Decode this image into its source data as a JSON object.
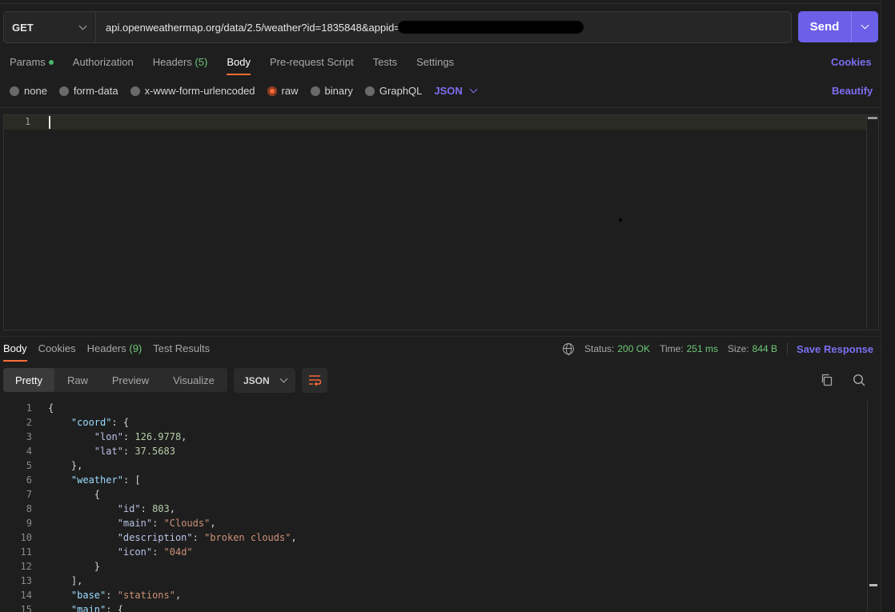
{
  "request": {
    "method": "GET",
    "url": "api.openweathermap.org/data/2.5/weather?id=1835848&appid=",
    "send_label": "Send"
  },
  "request_tabs": [
    {
      "label": "Params",
      "active": false
    },
    {
      "label": "Authorization",
      "active": false
    },
    {
      "label": "Headers",
      "count": "(5)",
      "active": false
    },
    {
      "label": "Body",
      "active": true
    },
    {
      "label": "Pre-request Script",
      "active": false
    },
    {
      "label": "Tests",
      "active": false
    },
    {
      "label": "Settings",
      "active": false
    }
  ],
  "cookies_link": "Cookies",
  "body_types": [
    {
      "label": "none",
      "selected": false
    },
    {
      "label": "form-data",
      "selected": false
    },
    {
      "label": "x-www-form-urlencoded",
      "selected": false
    },
    {
      "label": "raw",
      "selected": true
    },
    {
      "label": "binary",
      "selected": false
    },
    {
      "label": "GraphQL",
      "selected": false
    }
  ],
  "body_format": "JSON",
  "beautify_label": "Beautify",
  "editor": {
    "line_number": "1"
  },
  "response_tabs": [
    {
      "label": "Body",
      "active": true
    },
    {
      "label": "Cookies",
      "active": false
    },
    {
      "label": "Headers",
      "count": "(9)",
      "active": false
    },
    {
      "label": "Test Results",
      "active": false
    }
  ],
  "response_status": {
    "status_label": "Status:",
    "status_value": "200 OK",
    "time_label": "Time:",
    "time_value": "251 ms",
    "size_label": "Size:",
    "size_value": "844 B",
    "save_label": "Save Response"
  },
  "view_modes": [
    {
      "label": "Pretty",
      "active": true
    },
    {
      "label": "Raw",
      "active": false
    },
    {
      "label": "Preview",
      "active": false
    },
    {
      "label": "Visualize",
      "active": false
    }
  ],
  "response_format": "JSON",
  "response_lines": [
    {
      "n": "1",
      "tokens": [
        [
          "p",
          "{"
        ]
      ]
    },
    {
      "n": "2",
      "tokens": [
        [
          "p",
          "    "
        ],
        [
          "k",
          "\"coord\""
        ],
        [
          "p",
          ": {"
        ]
      ]
    },
    {
      "n": "3",
      "tokens": [
        [
          "p",
          "        "
        ],
        [
          "kk",
          "\"lon\""
        ],
        [
          "p",
          ": "
        ],
        [
          "n",
          "126.9778"
        ],
        [
          "p",
          ","
        ]
      ]
    },
    {
      "n": "4",
      "tokens": [
        [
          "p",
          "        "
        ],
        [
          "kk",
          "\"lat\""
        ],
        [
          "p",
          ": "
        ],
        [
          "n",
          "37.5683"
        ]
      ]
    },
    {
      "n": "5",
      "tokens": [
        [
          "p",
          "    },"
        ]
      ]
    },
    {
      "n": "6",
      "tokens": [
        [
          "p",
          "    "
        ],
        [
          "k",
          "\"weather\""
        ],
        [
          "p",
          ": ["
        ]
      ]
    },
    {
      "n": "7",
      "tokens": [
        [
          "p",
          "        {"
        ]
      ]
    },
    {
      "n": "8",
      "tokens": [
        [
          "p",
          "            "
        ],
        [
          "kk",
          "\"id\""
        ],
        [
          "p",
          ": "
        ],
        [
          "n",
          "803"
        ],
        [
          "p",
          ","
        ]
      ]
    },
    {
      "n": "9",
      "tokens": [
        [
          "p",
          "            "
        ],
        [
          "kk",
          "\"main\""
        ],
        [
          "p",
          ": "
        ],
        [
          "s",
          "\"Clouds\""
        ],
        [
          "p",
          ","
        ]
      ]
    },
    {
      "n": "10",
      "tokens": [
        [
          "p",
          "            "
        ],
        [
          "kk",
          "\"description\""
        ],
        [
          "p",
          ": "
        ],
        [
          "s",
          "\"broken clouds\""
        ],
        [
          "p",
          ","
        ]
      ]
    },
    {
      "n": "11",
      "tokens": [
        [
          "p",
          "            "
        ],
        [
          "kk",
          "\"icon\""
        ],
        [
          "p",
          ": "
        ],
        [
          "s",
          "\"04d\""
        ]
      ]
    },
    {
      "n": "12",
      "tokens": [
        [
          "p",
          "        }"
        ]
      ]
    },
    {
      "n": "13",
      "tokens": [
        [
          "p",
          "    ],"
        ]
      ]
    },
    {
      "n": "14",
      "tokens": [
        [
          "p",
          "    "
        ],
        [
          "k",
          "\"base\""
        ],
        [
          "p",
          ": "
        ],
        [
          "s",
          "\"stations\""
        ],
        [
          "p",
          ","
        ]
      ]
    },
    {
      "n": "15",
      "tokens": [
        [
          "p",
          "    "
        ],
        [
          "k",
          "\"main\""
        ],
        [
          "p",
          ": {"
        ]
      ]
    }
  ],
  "colors": {
    "accent": "#6c5fe8",
    "tab_underline": "#ff6c37",
    "status_green": "#6ec977",
    "link_purple": "#7b6ff0"
  }
}
